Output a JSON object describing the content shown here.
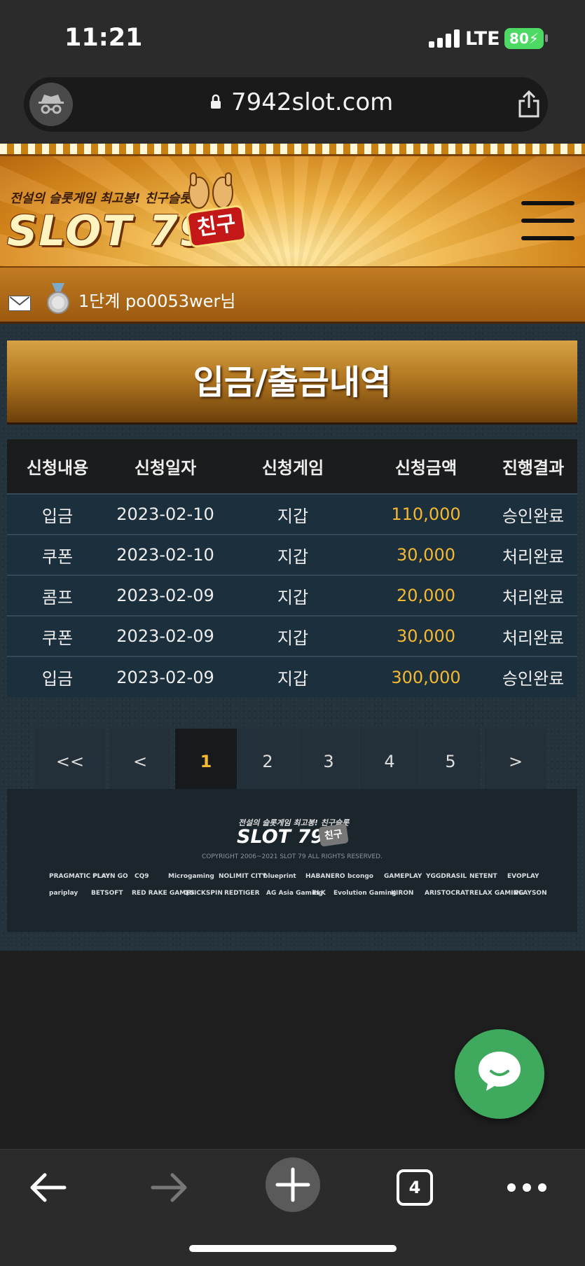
{
  "status": {
    "time": "11:21",
    "network": "LTE",
    "battery": "80"
  },
  "browser": {
    "url": "7942slot.com",
    "tab_count": "4"
  },
  "site": {
    "tagline": "전설의 슬롯게임 최고봉! 친구슬롯",
    "logo": "SLOT 79",
    "logo_badge": "친구"
  },
  "user": {
    "label": "1단계 po0053wer님"
  },
  "page": {
    "title": "입금/출금내역"
  },
  "table": {
    "headers": [
      "신청내용",
      "신청일자",
      "신청게임",
      "신청금액",
      "진행결과"
    ],
    "rows": [
      [
        "입금",
        "2023-02-10",
        "지갑",
        "110,000",
        "승인완료"
      ],
      [
        "쿠폰",
        "2023-02-10",
        "지갑",
        "30,000",
        "처리완료"
      ],
      [
        "콤프",
        "2023-02-09",
        "지갑",
        "20,000",
        "처리완료"
      ],
      [
        "쿠폰",
        "2023-02-09",
        "지갑",
        "30,000",
        "처리완료"
      ],
      [
        "입금",
        "2023-02-09",
        "지갑",
        "300,000",
        "승인완료"
      ]
    ]
  },
  "pagination": {
    "first": "<<",
    "prev": "<",
    "pages": [
      "1",
      "2",
      "3",
      "4",
      "5"
    ],
    "next": ">",
    "current": "1"
  },
  "footer": {
    "tagline": "전설의 슬롯게임 최고봉! 친구슬롯",
    "logo": "SLOT 79",
    "logo_badge": "친구",
    "copyright": "COPYRIGHT 2006~2021 SLOT 79 ALL RIGHTS RESERVED.",
    "providers_row1": [
      "PRAGMATIC PLAY",
      "PLAYN GO",
      "CQ9",
      "Microgaming",
      "NOLIMIT CITY",
      "blueprint",
      "HABANERO",
      "bcongo",
      "GAMEPLAY",
      "YGGDRASIL",
      "NETENT",
      "EVOPLAY"
    ],
    "providers_row2": [
      "pariplay",
      "BETSOFT",
      "RED RAKE GAMES",
      "QUICKSPIN",
      "REDTIGER",
      "AG Asia Gaming",
      "ELK",
      "Evolution Gaming",
      "KIRON",
      "ARISTOCRAT",
      "RELAX GAMING",
      "PLAYSON"
    ]
  },
  "colors": {
    "accent_gold": "#f5b833",
    "chat_green": "#3fa95e"
  }
}
